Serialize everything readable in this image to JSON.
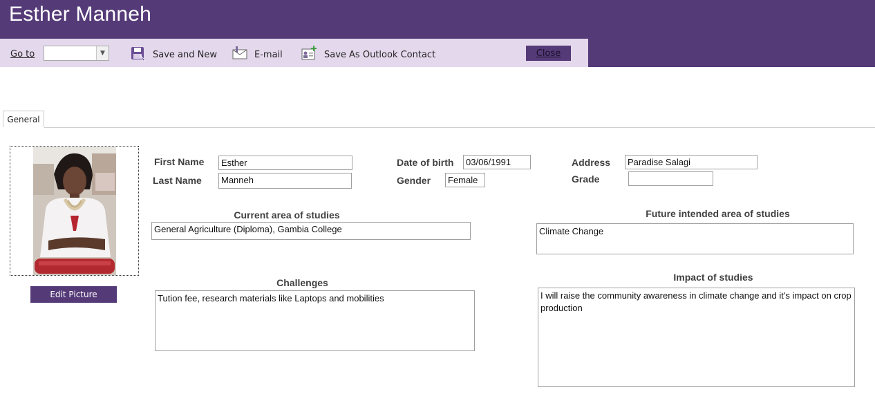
{
  "window": {
    "title": "Esther Manneh"
  },
  "toolbar": {
    "goto_label": "Go to",
    "goto_value": "",
    "save_new_label": "Save and New",
    "email_label": "E-mail",
    "save_outlook_label": "Save As Outlook Contact",
    "close_label": "Close"
  },
  "tabs": [
    {
      "label": "General"
    }
  ],
  "photo": {
    "edit_label": "Edit Picture"
  },
  "form": {
    "first_name_label": "First Name",
    "first_name": "Esther",
    "last_name_label": "Last Name",
    "last_name": "Manneh",
    "dob_label": "Date of birth",
    "dob": "03/06/1991",
    "gender_label": "Gender",
    "gender": "Female",
    "address_label": "Address",
    "address": "Paradise Salagi",
    "grade_label": "Grade",
    "grade": "",
    "current_studies_label": "Current area of studies",
    "current_studies": "General Agriculture (Diploma), Gambia College",
    "future_studies_label": "Future intended area of studies",
    "future_studies": "Climate Change",
    "challenges_label": "Challenges",
    "challenges": "Tution fee, research materials like Laptops and mobilities",
    "impact_label": "Impact of studies",
    "impact": "I will raise the community awareness in climate change and it's impact on crop production"
  },
  "colors": {
    "accent": "#553a78",
    "toolbar_bg": "#e4d8ec"
  }
}
